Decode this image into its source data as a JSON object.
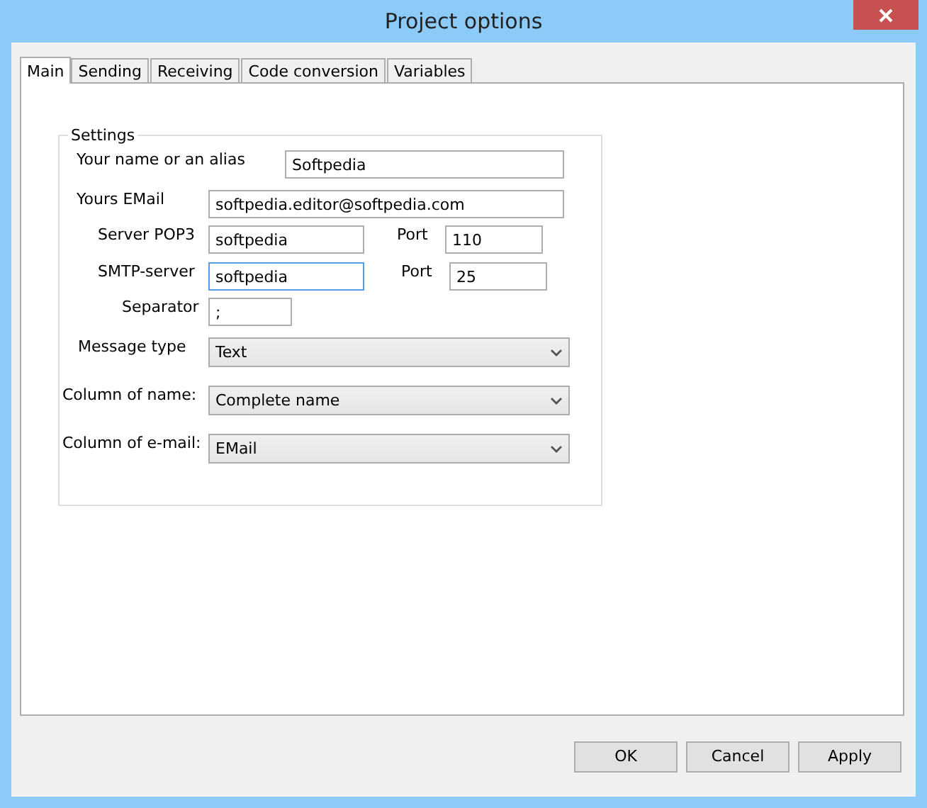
{
  "window": {
    "title": "Project options"
  },
  "tabs": [
    {
      "label": "Main",
      "selected": true
    },
    {
      "label": "Sending",
      "selected": false
    },
    {
      "label": "Receiving",
      "selected": false
    },
    {
      "label": "Code conversion",
      "selected": false
    },
    {
      "label": "Variables",
      "selected": false
    }
  ],
  "settings": {
    "title": "Settings",
    "rows": [
      {
        "kind": "text",
        "label": "Your name or an alias",
        "value": "Softpedia",
        "focused": false
      },
      {
        "kind": "text",
        "label": "Yours EMail",
        "value": "softpedia.editor@softpedia.com",
        "focused": false
      },
      {
        "kind": "text-port",
        "label": "Server POP3",
        "value": "softpedia",
        "focused": false,
        "port_label": "Port",
        "port": "110"
      },
      {
        "kind": "text-port",
        "label": "SMTP-server",
        "value": "softpedia",
        "focused": true,
        "port_label": "Port",
        "port": "25"
      },
      {
        "kind": "text",
        "label": "Separator",
        "value": ";",
        "focused": false
      },
      {
        "kind": "select",
        "label": "Message type",
        "value": "Text"
      },
      {
        "kind": "select",
        "label": "Column of name:",
        "value": "Complete name"
      },
      {
        "kind": "select",
        "label": "Column of e-mail:",
        "value": "EMail"
      }
    ]
  },
  "buttons": [
    "OK",
    "Cancel",
    "Apply"
  ]
}
